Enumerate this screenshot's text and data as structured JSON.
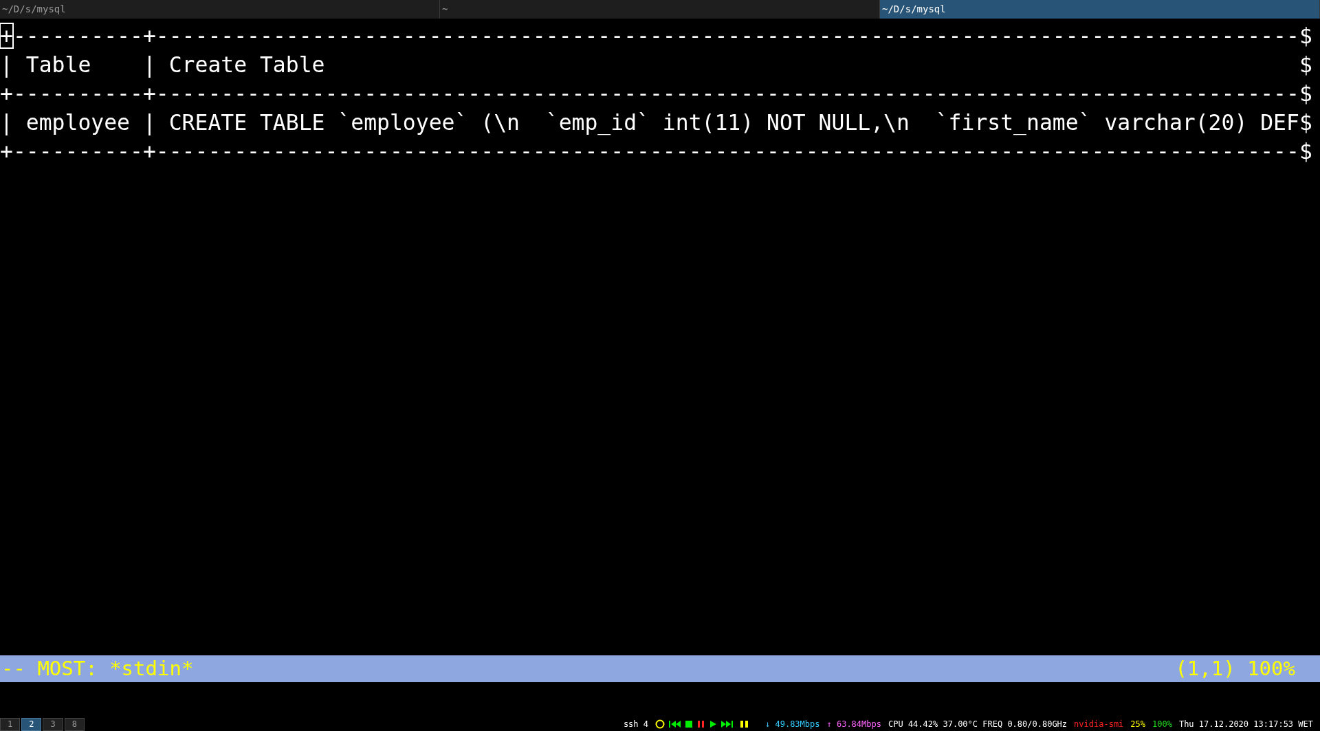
{
  "tabs": [
    {
      "label": "~/D/s/mysql",
      "selected": false
    },
    {
      "label": "~",
      "selected": false
    },
    {
      "label": "~/D/s/mysql",
      "selected": true
    }
  ],
  "terminal": {
    "cursor_visible": true,
    "lines": [
      "+----------+----------------------------------------------------------------------------------------$",
      "| Table    | Create Table                                                                           $",
      "+----------+----------------------------------------------------------------------------------------$",
      "| employee | CREATE TABLE `employee` (\\n  `emp_id` int(11) NOT NULL,\\n  `first_name` varchar(20) DEF$",
      "+----------+----------------------------------------------------------------------------------------$"
    ]
  },
  "status_line": {
    "left": "-- MOST: *stdin*",
    "right": "(1,1) 100%"
  },
  "bottom_bar": {
    "workspaces": [
      {
        "label": "1",
        "selected": false
      },
      {
        "label": "2",
        "selected": true
      },
      {
        "label": "3",
        "selected": false
      },
      {
        "label": "8",
        "selected": false
      }
    ],
    "items": [
      {
        "kind": "text",
        "text": "ssh 4",
        "color": "#ffffff"
      },
      {
        "kind": "media"
      },
      {
        "kind": "text",
        "text": "↓ 49.83Mbps",
        "color": "#33ccff"
      },
      {
        "kind": "text",
        "text": "↑ 63.84Mbps",
        "color": "#ff66ff"
      },
      {
        "kind": "text",
        "text": "CPU 44.42% 37.00°C FREQ 0.80/0.80GHz",
        "color": "#ffffff"
      },
      {
        "kind": "text",
        "text": "nvidia-smi",
        "color": "#ff2222"
      },
      {
        "kind": "text",
        "text": "25%",
        "color": "#ffff00"
      },
      {
        "kind": "text",
        "text": "100%",
        "color": "#22dd22"
      },
      {
        "kind": "text",
        "text": "Thu 17.12.2020 13:17:53 WET",
        "color": "#ffffff"
      }
    ]
  }
}
